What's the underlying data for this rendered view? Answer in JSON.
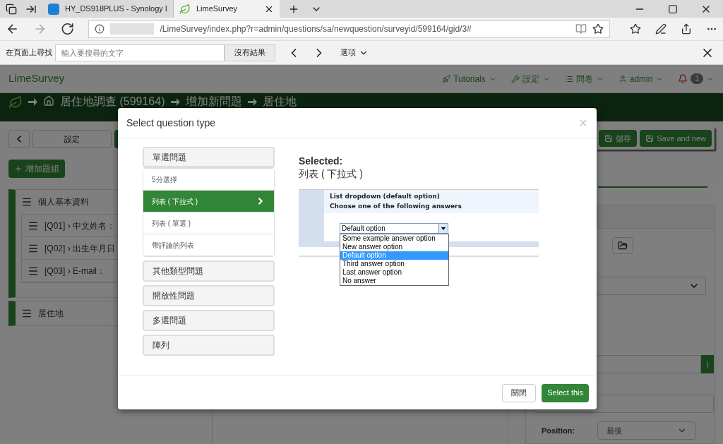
{
  "browser": {
    "tabs": [
      {
        "title": "HY_DS918PLUS - Synology I",
        "selected": false
      },
      {
        "title": "LimeSurvey",
        "selected": true
      }
    ],
    "address": "/LimeSurvey/index.php?r=admin/questions/sa/newquestion/surveyid/599164/gid/3#",
    "find_bar": {
      "label": "在頁面上尋找",
      "placeholder": "輸入要搜尋的文字",
      "result": "沒有結果",
      "options": "選項"
    }
  },
  "nav": {
    "brand": "LimeSurvey",
    "items": [
      "Tutorials",
      "設定",
      "問卷",
      "admin"
    ],
    "notification_count": "1"
  },
  "breadcrumb": [
    "居住地調查 (599164)",
    "增加新問題",
    "居住地"
  ],
  "toolbar": {
    "left": "設定",
    "right": [
      "儲存",
      "Save and new"
    ]
  },
  "add_group": "增加題組",
  "groups": [
    {
      "name": "個人基本資料",
      "questions": [
        "[Q01] › 中文姓名：",
        "[Q02] › 出生年月日",
        "[Q03] › E-mail："
      ]
    },
    {
      "name": "居住地"
    }
  ],
  "form": {
    "addon": "}",
    "position_label": "Position:",
    "position_value": "最後"
  },
  "modal": {
    "title": "Select question type",
    "categories": [
      {
        "label": "單選問題",
        "expanded": true,
        "types": [
          {
            "label": "5分選擇",
            "selected": false
          },
          {
            "label": "列表 ( 下拉式 )",
            "selected": true
          },
          {
            "label": "列表 ( 單選 )",
            "selected": false
          },
          {
            "label": "帶評論的列表",
            "selected": false
          }
        ]
      },
      {
        "label": "其他類型問題",
        "expanded": false
      },
      {
        "label": "開放性問題",
        "expanded": false
      },
      {
        "label": "多選問題",
        "expanded": false
      },
      {
        "label": "陣列",
        "expanded": false
      }
    ],
    "selected_heading": "Selected:",
    "selected_name": "列表 ( 下拉式 )",
    "preview": {
      "title": "List dropdown (default option)",
      "subtitle": "Choose one of the following answers",
      "value": "Default option",
      "options": [
        {
          "label": "Some example answer option",
          "selected": false
        },
        {
          "label": "New answer option",
          "selected": false
        },
        {
          "label": "Default option",
          "selected": true
        },
        {
          "label": "Third answer option",
          "selected": false
        },
        {
          "label": "Last answer option",
          "selected": false
        },
        {
          "label": "No answer",
          "selected": false
        }
      ]
    },
    "buttons": [
      "關閉",
      "Select this"
    ]
  }
}
